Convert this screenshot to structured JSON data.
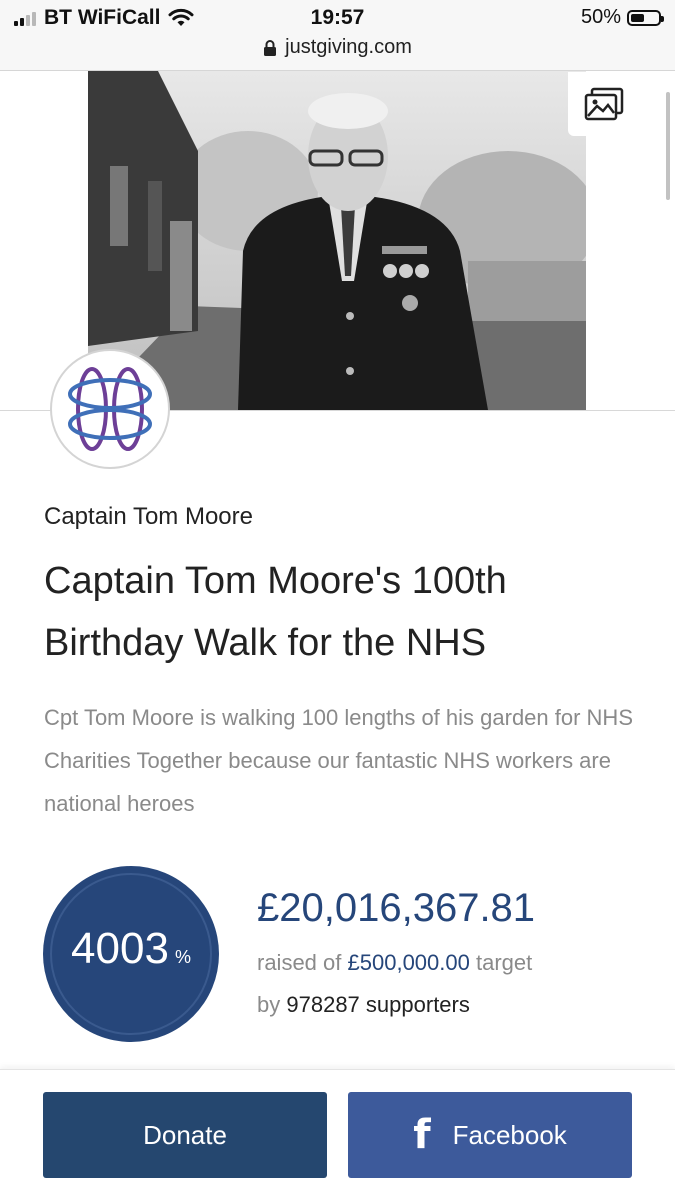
{
  "status_bar": {
    "carrier": "BT WiFiCall",
    "time": "19:57",
    "battery": "50%",
    "battery_level": 0.5,
    "url": "justgiving.com"
  },
  "page": {
    "owner": "Captain Tom Moore",
    "title": "Captain Tom Moore's 100th Birthday Walk for the NHS",
    "description": "Cpt Tom Moore is walking 100 lengths of his garden for NHS Charities Together because our fantastic NHS workers are national heroes",
    "percent": "4003",
    "percent_sign": "%",
    "raised": "£20,016,367.81",
    "raised_prefix": "raised of",
    "target": "£500,000.00",
    "target_suffix": "target",
    "supporters_prefix": "by",
    "supporters_count": "978287",
    "supporters_suffix": "supporters"
  },
  "buttons": {
    "donate": "Donate",
    "facebook": "Facebook"
  },
  "colors": {
    "brand_navy": "#26467a",
    "facebook_blue": "#3d5a9b"
  },
  "icons": [
    "wifi-icon",
    "lock-icon",
    "battery-icon",
    "gallery-icon",
    "facebook-icon"
  ]
}
